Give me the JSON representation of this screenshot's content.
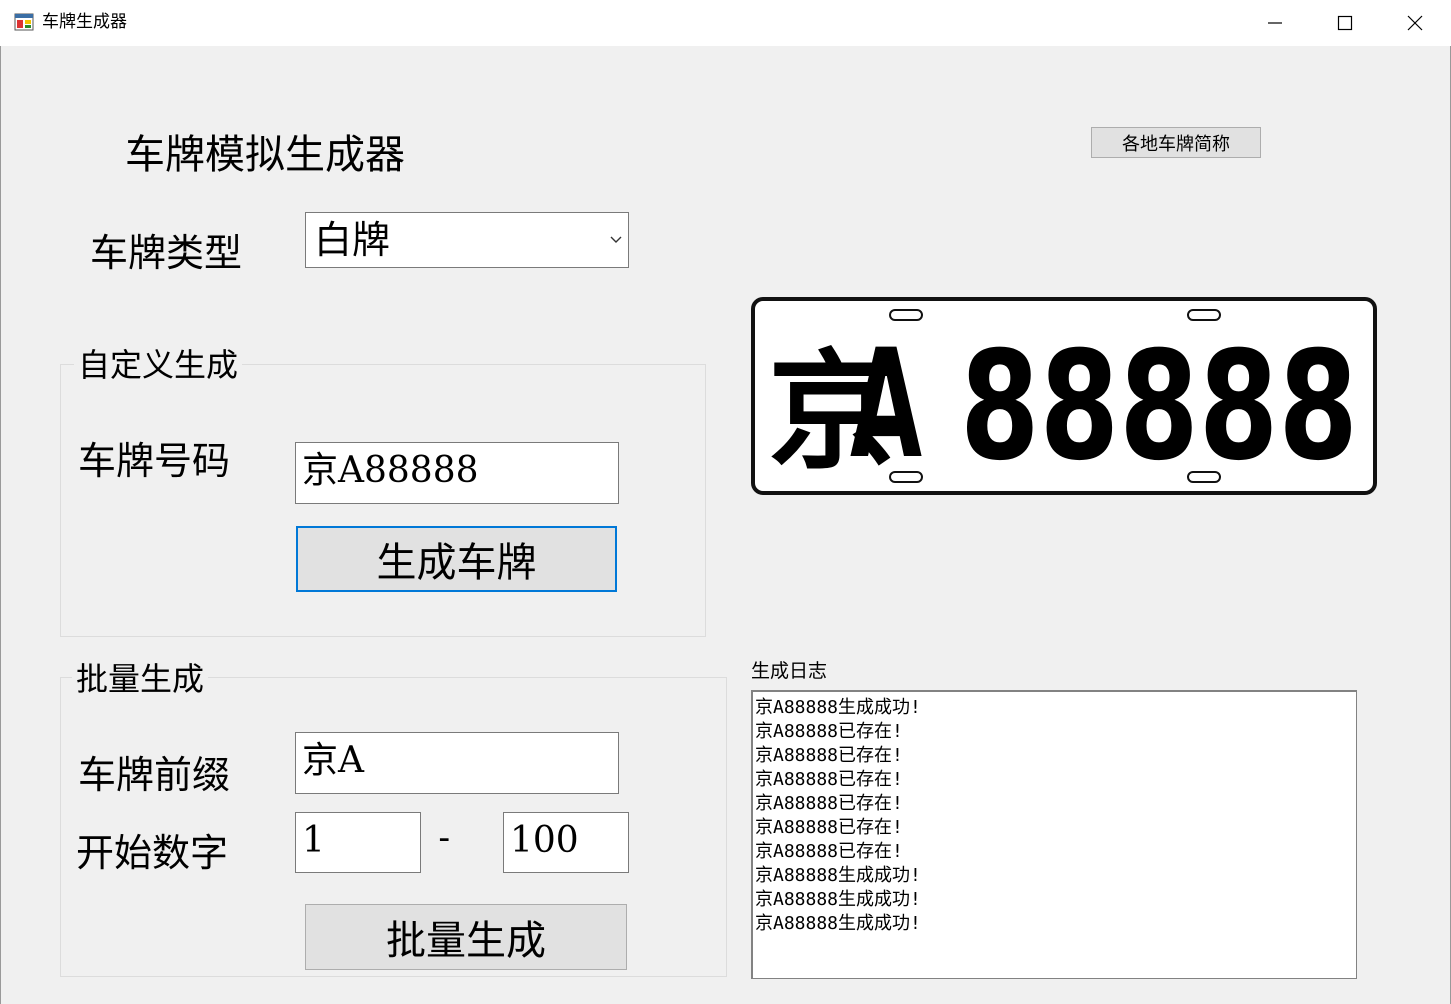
{
  "window": {
    "title": "车牌生成器",
    "icon": "app-form-icon",
    "controls": [
      "minimize-icon",
      "maximize-icon",
      "close-icon"
    ]
  },
  "header": {
    "title": "车牌模拟生成器"
  },
  "toolbar": {
    "abbrev_button": "各地车牌简称"
  },
  "plate_type": {
    "label": "车牌类型",
    "selected": "白牌"
  },
  "custom": {
    "group_title": "自定义生成",
    "number_label": "车牌号码",
    "number_value": "京A88888",
    "generate_button": "生成车牌"
  },
  "batch": {
    "group_title": "批量生成",
    "prefix_label": "车牌前缀",
    "prefix_value": "京A",
    "start_label": "开始数字",
    "start_value": "1",
    "dash": "-",
    "end_value": "100",
    "batch_button": "批量生成"
  },
  "preview": {
    "plate_province": "京",
    "plate_letter": "A",
    "plate_digits": "88888"
  },
  "log": {
    "title": "生成日志",
    "lines": [
      "京A88888生成成功!",
      "京A88888已存在!",
      "京A88888已存在!",
      "京A88888已存在!",
      "京A88888已存在!",
      "京A88888已存在!",
      "京A88888已存在!",
      "京A88888生成成功!",
      "京A88888生成成功!",
      "京A88888生成成功!"
    ]
  },
  "colors": {
    "focus_border": "#0078d7",
    "window_bg": "#f0f0f0",
    "button_bg": "#e1e1e1"
  }
}
